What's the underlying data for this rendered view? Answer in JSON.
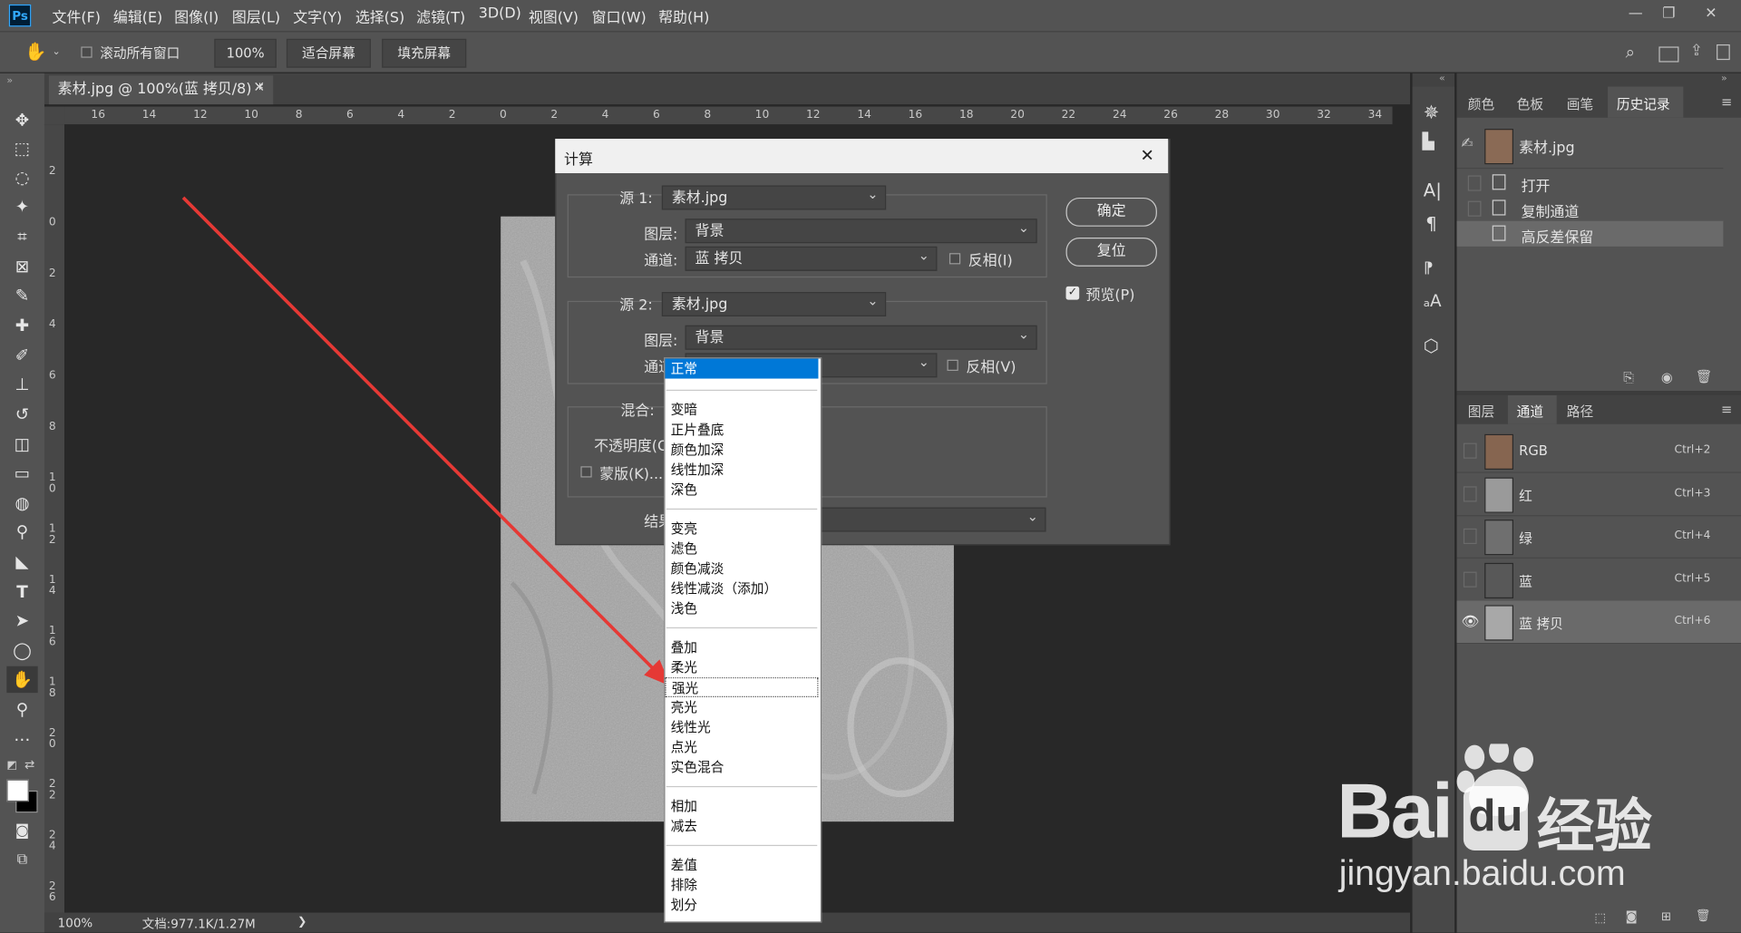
{
  "app": {
    "logo": "Ps",
    "menu": [
      "文件(F)",
      "编辑(E)",
      "图像(I)",
      "图层(L)",
      "文字(Y)",
      "选择(S)",
      "滤镜(T)",
      "3D(D)",
      "视图(V)",
      "窗口(W)",
      "帮助(H)"
    ],
    "window_controls": [
      "—",
      "❐",
      "✕"
    ]
  },
  "options": {
    "tool_icon": "hand-icon",
    "scroll_all_label": "滚动所有窗口",
    "zoom_value": "100%",
    "fit_screen": "适合屏幕",
    "fill_screen": "填充屏幕"
  },
  "document": {
    "tab_title": "素材.jpg @ 100%(蓝 拷贝/8) *",
    "close": "×",
    "ruler_h": [
      "16",
      "14",
      "12",
      "10",
      "8",
      "6",
      "4",
      "2",
      "0",
      "2",
      "4",
      "6",
      "8",
      "10",
      "12",
      "14",
      "16",
      "18",
      "20",
      "22",
      "24",
      "26",
      "28",
      "30",
      "32",
      "34"
    ],
    "ruler_v": [
      "2",
      "0",
      "2",
      "4",
      "6",
      "8",
      "1\n0",
      "1\n2",
      "1\n4",
      "1\n6",
      "1\n8",
      "2\n0",
      "2\n2",
      "2\n4",
      "2\n6"
    ],
    "status_zoom": "100%",
    "status_doc": "文档:977.1K/1.27M",
    "status_arrow": "❯"
  },
  "history_panel": {
    "tabs": [
      "颜色",
      "色板",
      "画笔",
      "历史记录"
    ],
    "active_tab": "历史记录",
    "snapshot": "素材.jpg",
    "items": [
      "打开",
      "复制通道",
      "高反差保留"
    ]
  },
  "channels_panel": {
    "tabs": [
      "图层",
      "通道",
      "路径"
    ],
    "active_tab": "通道",
    "rows": [
      {
        "name": "RGB",
        "shortcut": "Ctrl+2"
      },
      {
        "name": "红",
        "shortcut": "Ctrl+3"
      },
      {
        "name": "绿",
        "shortcut": "Ctrl+4"
      },
      {
        "name": "蓝",
        "shortcut": "Ctrl+5"
      },
      {
        "name": "蓝 拷贝",
        "shortcut": "Ctrl+6"
      }
    ]
  },
  "dialog": {
    "title": "计算",
    "close": "✕",
    "source1": {
      "label": "源 1:",
      "file": "素材.jpg",
      "layer_label": "图层:",
      "layer": "背景",
      "channel_label": "通道:",
      "channel": "蓝 拷贝",
      "invert": "反相(I)"
    },
    "source2": {
      "label": "源 2:",
      "file": "素材.jpg",
      "layer_label": "图层:",
      "layer": "背景",
      "channel_label": "通道",
      "invert": "反相(V)"
    },
    "blend_label": "混合:",
    "opacity_label": "不透明度(O",
    "mask_label": "蒙版(K)...",
    "result_label": "结果",
    "ok": "确定",
    "reset": "复位",
    "preview": "预览(P)",
    "preview_checked": true
  },
  "blend_list": {
    "selected": "正常",
    "hovered": "强光",
    "groups": [
      [
        "正常"
      ],
      [
        "变暗",
        "正片叠底",
        "颜色加深",
        "线性加深",
        "深色"
      ],
      [
        "变亮",
        "滤色",
        "颜色减淡",
        "线性减淡（添加）",
        "浅色"
      ],
      [
        "叠加",
        "柔光",
        "强光",
        "亮光",
        "线性光",
        "点光",
        "实色混合"
      ],
      [
        "相加",
        "减去"
      ],
      [
        "差值",
        "排除",
        "划分"
      ]
    ]
  },
  "watermark": {
    "brand": "Bai",
    "brand2": "du",
    "cn": "经验",
    "url": "jingyan.baidu.com"
  },
  "colors": {
    "accent_select": "#0078d7",
    "arrow": "#e53935"
  }
}
